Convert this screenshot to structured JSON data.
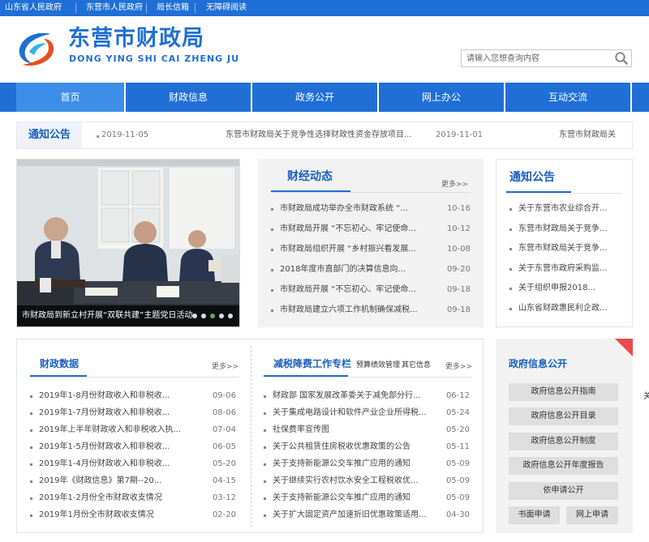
{
  "topbar": {
    "links": [
      "山东省人民政府",
      "东营市人民政府",
      "局长信箱",
      "无障碍阅读"
    ]
  },
  "header": {
    "title": "东营市财政局",
    "subtitle": "DONG YING SHI CAI ZHENG JU"
  },
  "search": {
    "placeholder": "请输入您想查询内容",
    "icon": "search-icon"
  },
  "nav": {
    "items": [
      "首页",
      "财政信息",
      "政务公开",
      "网上办公",
      "互动交流"
    ],
    "active_index": 0
  },
  "ticker": {
    "tag": "通知公告",
    "items": [
      {
        "date": "2019-11-05",
        "title": "东营市财政局关于竞争性选择财政性资金存放项目..."
      },
      {
        "date": "2019-11-01",
        "title": "东营市财政局关"
      }
    ]
  },
  "photo": {
    "caption": "市财政局到新立村开展“双联共建”主题党日活动",
    "slide_count": 5,
    "active_slide": 2
  },
  "finance_news": {
    "title": "财经动态",
    "more": "更多>>",
    "items": [
      {
        "title": "市财政局成功举办全市财政系统 “...",
        "date": "10-16"
      },
      {
        "title": "市财政局开展 “不忘初心、牢记使命...",
        "date": "10-12"
      },
      {
        "title": "市财政局组织开展 “乡村振兴看发展...",
        "date": "10-08"
      },
      {
        "title": "2018年度市直部门的决算信息向...",
        "date": "09-20"
      },
      {
        "title": "市财政局开展 “不忘初心、牢记使命...",
        "date": "09-18"
      },
      {
        "title": "市财政局建立六项工作机制确保减税...",
        "date": "09-18"
      }
    ]
  },
  "notices": {
    "title": "通知公告",
    "items": [
      "关于东营市农业综合开...",
      "东营市财政局关于竞争...",
      "东营市财政局关于竞争...",
      "关于东营市政府采购监...",
      "关于组织申报2018...",
      "山东省财政惠民利企政..."
    ]
  },
  "finance_data": {
    "title": "财政数据",
    "more": "更多>>",
    "items": [
      {
        "title": "2019年1-8月份财政收入和非税收...",
        "date": "09-06"
      },
      {
        "title": "2019年1-7月份财政收入和非税收...",
        "date": "08-06"
      },
      {
        "title": "2019年上半年财政收入和非税收入执...",
        "date": "07-04"
      },
      {
        "title": "2019年1-5月份财政收入和非税收...",
        "date": "06-05"
      },
      {
        "title": "2019年1-4月份财政收入和非税收...",
        "date": "05-20"
      },
      {
        "title": "2019年《财政信息》第7期--20...",
        "date": "04-15"
      },
      {
        "title": "2019年1-2月份全市财政收支情况",
        "date": "03-12"
      },
      {
        "title": "2019年1月份全市财政收支情况",
        "date": "02-20"
      }
    ]
  },
  "tax_column": {
    "title": "减税降费工作专栏",
    "tabs": [
      "预算绩效管理",
      "其它信息"
    ],
    "more": "更多>>",
    "items": [
      {
        "title": "财政部 国家发展改革委关于减免部分行...",
        "date": "06-12"
      },
      {
        "title": "关于集成电路设计和软件产业企业所得税...",
        "date": "05-24"
      },
      {
        "title": "社保费率宣传图",
        "date": "05-20"
      },
      {
        "title": "关于公共租赁住房税收优惠政策的公告",
        "date": "05-11"
      },
      {
        "title": "关于支持新能源公交车推广应用的通知",
        "date": "05-09"
      },
      {
        "title": "关于继续实行农村饮水安全工程税收优...",
        "date": "05-09"
      },
      {
        "title": "关于支持新能源公交车推广应用的通知",
        "date": "05-09"
      },
      {
        "title": "关于扩大固定资产加速折旧优惠政策适用...",
        "date": "04-30"
      }
    ]
  },
  "gov_info": {
    "title": "政府信息公开",
    "buttons": [
      "政府信息公开指南",
      "政府信息公开目录",
      "政府信息公开制度",
      "政府信息公开年度报告",
      "依申请公开"
    ],
    "small_buttons": [
      "书面申请",
      "网上申请"
    ]
  },
  "edge_text": "关",
  "colors": {
    "brand_blue": "#1f6fd6",
    "nav_active": "#3d8ee8",
    "title_blue": "#1b5fbd",
    "corner_red": "#e84c4c"
  }
}
